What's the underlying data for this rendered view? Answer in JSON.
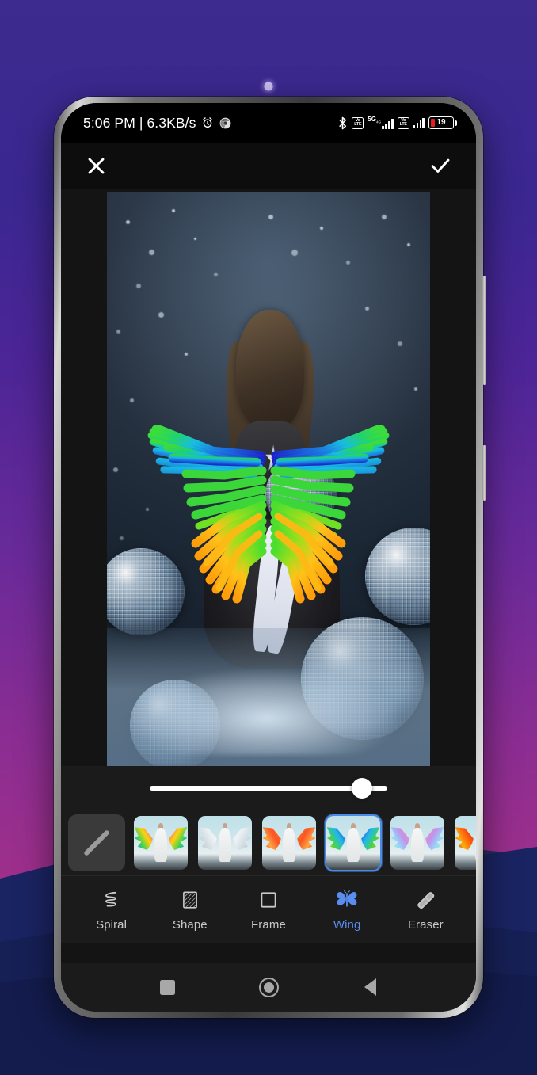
{
  "wallpaper": {
    "gradient_top": "#3d2b8f",
    "gradient_bottom": "#a63087",
    "mountain_colors": [
      "#2c2b63",
      "#1b2463",
      "#162055",
      "#131c4d"
    ]
  },
  "statusbar": {
    "clock": "5:06 PM | 6.3KB/s",
    "icons_left": [
      "alarm-icon",
      "chrome-icon"
    ],
    "icons_right": [
      "bluetooth-icon",
      "volte-icon",
      "signal-5g-icon",
      "volte-icon-2",
      "signal-icon-2",
      "battery-icon"
    ],
    "network_label": "5G",
    "network_sub": "4G",
    "volte_top": "Vo",
    "volte_bottom": "LTE",
    "battery_percent": "19"
  },
  "actionbar": {
    "close_label": "Close",
    "close_icon": "close-icon",
    "confirm_label": "Apply",
    "confirm_icon": "check-icon"
  },
  "editor": {
    "photo_alt": "Girl with rainbow wings sitting among disco balls",
    "slider": {
      "name": "opacity-slider",
      "value": 93,
      "min": 0,
      "max": 100
    }
  },
  "thumbnails": {
    "selected_index": 4,
    "selected_border_color": "#4a8ae8",
    "items": [
      {
        "id": "none",
        "label": "None",
        "icon": "slash-icon",
        "colors": []
      },
      {
        "id": "wing-1",
        "label": "Rainbow Magenta Wings",
        "colors": [
          "#ff2fae",
          "#ffd200",
          "#2fd24f",
          "#2f7dff"
        ]
      },
      {
        "id": "wing-2",
        "label": "White Angel Wings",
        "colors": [
          "#ffffff",
          "#e9eef2",
          "#cfd8de",
          "#b5c0c8"
        ]
      },
      {
        "id": "wing-3",
        "label": "Orange Fire Wings",
        "colors": [
          "#ff7a18",
          "#ff4d1a",
          "#ffa23a",
          "#e63900"
        ]
      },
      {
        "id": "wing-4",
        "label": "Rainbow Green Blue Wings",
        "colors": [
          "#1a2fd6",
          "#18b6e8",
          "#3fd43f",
          "#ffcc00"
        ]
      },
      {
        "id": "wing-5",
        "label": "Pastel Rainbow Wings",
        "colors": [
          "#ff8fb0",
          "#c08fe8",
          "#8fd8ff",
          "#b0f0a0"
        ]
      },
      {
        "id": "wing-6",
        "label": "Red Phoenix Wings",
        "colors": [
          "#e01010",
          "#ff5a00",
          "#ffae00",
          "#8a0000"
        ]
      }
    ]
  },
  "toolbar": {
    "active_color": "#5a8df0",
    "inactive_color": "#c9c9c9",
    "active_id": "wing",
    "tools": [
      {
        "id": "spiral",
        "label": "Spiral",
        "icon": "spiral-icon"
      },
      {
        "id": "shape",
        "label": "Shape",
        "icon": "shape-hatched-icon"
      },
      {
        "id": "frame",
        "label": "Frame",
        "icon": "frame-square-icon"
      },
      {
        "id": "wing",
        "label": "Wing",
        "icon": "butterfly-icon"
      },
      {
        "id": "eraser",
        "label": "Eraser",
        "icon": "eraser-icon"
      }
    ]
  },
  "navbar": {
    "buttons": [
      {
        "id": "recent",
        "label": "Recents",
        "icon": "square-icon"
      },
      {
        "id": "home",
        "label": "Home",
        "icon": "circle-icon"
      },
      {
        "id": "back",
        "label": "Back",
        "icon": "triangle-back-icon"
      }
    ]
  }
}
